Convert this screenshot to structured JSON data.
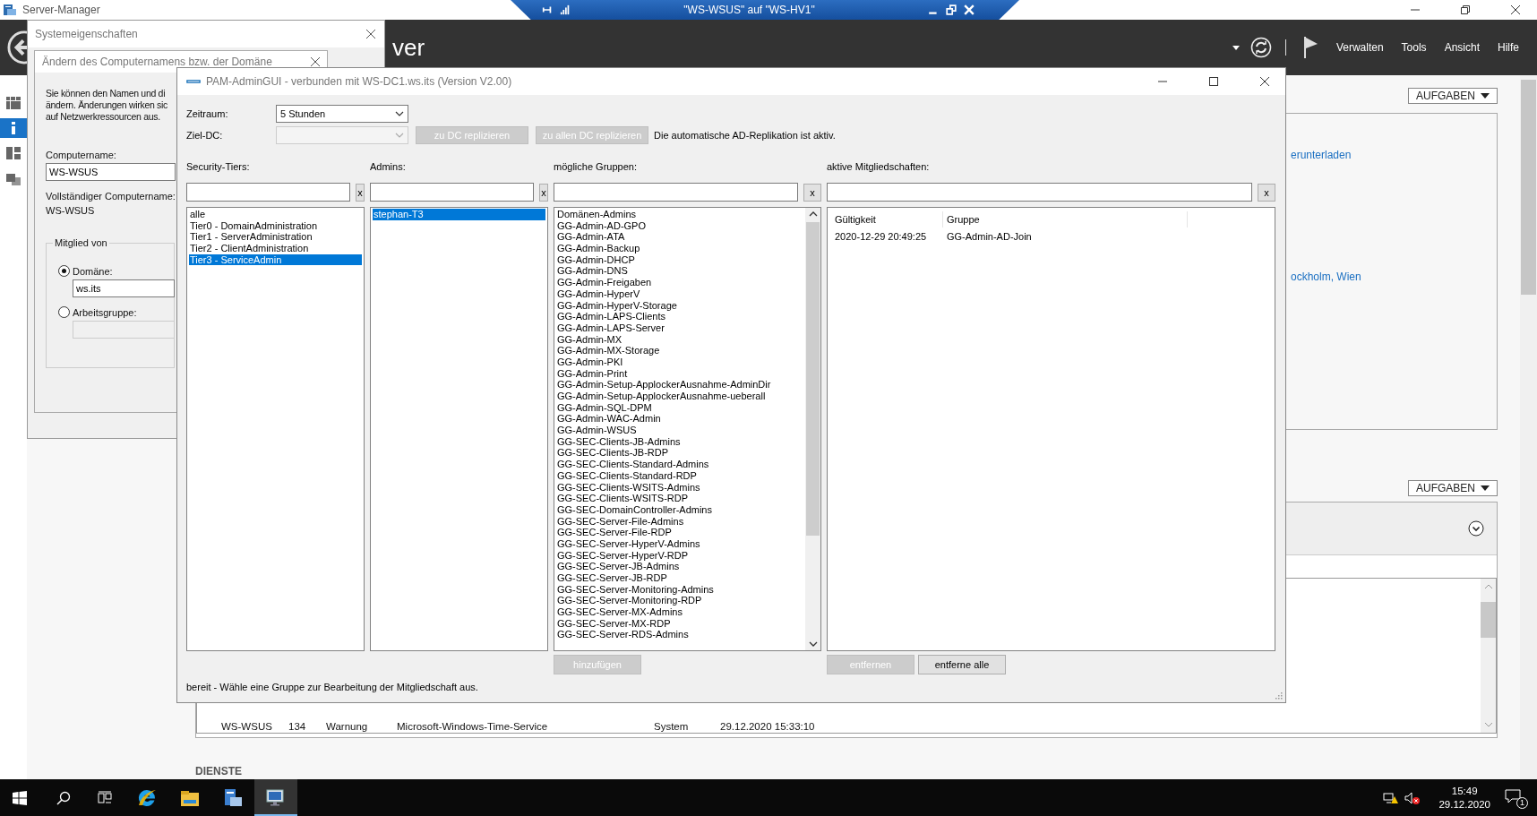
{
  "server_manager": {
    "title": "Server-Manager",
    "header_title": "ver",
    "menu": [
      "Verwalten",
      "Tools",
      "Ansicht",
      "Hilfe"
    ],
    "nav": [
      {
        "selected": false
      },
      {
        "selected": true
      },
      {
        "selected": false
      },
      {
        "selected": false
      }
    ],
    "tasks_buttons": [
      "AUFGABEN",
      "AUFGABEN"
    ],
    "links": [
      "erunterladen",
      "ockholm, Wien"
    ],
    "events_row": [
      "WS-WSUS",
      "134",
      "Warnung",
      "Microsoft-Windows-Time-Service",
      "System",
      "29.12.2020 15:33:10"
    ],
    "section": "DIENSTE"
  },
  "remote_bar": {
    "title": "\"WS-WSUS\" auf \"WS-HV1\""
  },
  "system_properties": {
    "title": "Systemeigenschaften",
    "dialog_title": "Ändern des Computernamens bzw. der Domäne",
    "intro": [
      "Sie können den Namen und di",
      "ändern. Änderungen wirken sic",
      "auf Netzwerkressourcen aus."
    ],
    "computer_name_label": "Computername:",
    "computer_name": "WS-WSUS",
    "full_name_label": "Vollständiger Computername:",
    "full_name": "WS-WSUS",
    "member_of": "Mitglied von",
    "options": [
      {
        "label": "Domäne:",
        "selected": true,
        "value": "ws.its"
      },
      {
        "label": "Arbeitsgruppe:",
        "selected": false
      }
    ]
  },
  "pam": {
    "title": "PAM-AdminGUI - verbunden mit WS-DC1.ws.its (Version V2.00)",
    "timeframe": {
      "label": "Zeitraum:",
      "value": "5 Stunden"
    },
    "target_dc": {
      "label": "Ziel-DC:",
      "disabled": true
    },
    "replicate_buttons": [
      {
        "label": "zu DC replizieren",
        "disabled": true
      },
      {
        "label": "zu allen DC replizieren",
        "disabled": true
      }
    ],
    "replication_note": "Die automatische AD-Replikation ist aktiv.",
    "columns": [
      {
        "label": "Security-Tiers:",
        "clear": "x",
        "scroll": false,
        "items": [
          {
            "text": "alle",
            "selected": false
          },
          {
            "text": "Tier0 - DomainAdministration",
            "selected": false
          },
          {
            "text": "Tier1 - ServerAdministration",
            "selected": false
          },
          {
            "text": "Tier2 - ClientAdministration",
            "selected": false
          },
          {
            "text": "Tier3 - ServiceAdmin",
            "selected": true
          }
        ]
      },
      {
        "label": "Admins:",
        "clear": "x",
        "scroll": false,
        "items": [
          {
            "text": "stephan-T3",
            "selected": true
          }
        ]
      },
      {
        "label": "mögliche Gruppen:",
        "clear": "x",
        "scroll": true,
        "items": [
          {
            "text": "Domänen-Admins",
            "selected": false
          },
          {
            "text": "GG-Admin-AD-GPO",
            "selected": false
          },
          {
            "text": "GG-Admin-ATA",
            "selected": false
          },
          {
            "text": "GG-Admin-Backup",
            "selected": false
          },
          {
            "text": "GG-Admin-DHCP",
            "selected": false
          },
          {
            "text": "GG-Admin-DNS",
            "selected": false
          },
          {
            "text": "GG-Admin-Freigaben",
            "selected": false
          },
          {
            "text": "GG-Admin-HyperV",
            "selected": false
          },
          {
            "text": "GG-Admin-HyperV-Storage",
            "selected": false
          },
          {
            "text": "GG-Admin-LAPS-Clients",
            "selected": false
          },
          {
            "text": "GG-Admin-LAPS-Server",
            "selected": false
          },
          {
            "text": "GG-Admin-MX",
            "selected": false
          },
          {
            "text": "GG-Admin-MX-Storage",
            "selected": false
          },
          {
            "text": "GG-Admin-PKI",
            "selected": false
          },
          {
            "text": "GG-Admin-Print",
            "selected": false
          },
          {
            "text": "GG-Admin-Setup-ApplockerAusnahme-AdminDir",
            "selected": false
          },
          {
            "text": "GG-Admin-Setup-ApplockerAusnahme-ueberall",
            "selected": false
          },
          {
            "text": "GG-Admin-SQL-DPM",
            "selected": false
          },
          {
            "text": "GG-Admin-WAC-Admin",
            "selected": false
          },
          {
            "text": "GG-Admin-WSUS",
            "selected": false
          },
          {
            "text": "GG-SEC-Clients-JB-Admins",
            "selected": false
          },
          {
            "text": "GG-SEC-Clients-JB-RDP",
            "selected": false
          },
          {
            "text": "GG-SEC-Clients-Standard-Admins",
            "selected": false
          },
          {
            "text": "GG-SEC-Clients-Standard-RDP",
            "selected": false
          },
          {
            "text": "GG-SEC-Clients-WSITS-Admins",
            "selected": false
          },
          {
            "text": "GG-SEC-Clients-WSITS-RDP",
            "selected": false
          },
          {
            "text": "GG-SEC-DomainController-Admins",
            "selected": false
          },
          {
            "text": "GG-SEC-Server-File-Admins",
            "selected": false
          },
          {
            "text": "GG-SEC-Server-File-RDP",
            "selected": false
          },
          {
            "text": "GG-SEC-Server-HyperV-Admins",
            "selected": false
          },
          {
            "text": "GG-SEC-Server-HyperV-RDP",
            "selected": false
          },
          {
            "text": "GG-SEC-Server-JB-Admins",
            "selected": false
          },
          {
            "text": "GG-SEC-Server-JB-RDP",
            "selected": false
          },
          {
            "text": "GG-SEC-Server-Monitoring-Admins",
            "selected": false
          },
          {
            "text": "GG-SEC-Server-Monitoring-RDP",
            "selected": false
          },
          {
            "text": "GG-SEC-Server-MX-Admins",
            "selected": false
          },
          {
            "text": "GG-SEC-Server-MX-RDP",
            "selected": false
          },
          {
            "text": "GG-SEC-Server-RDS-Admins",
            "selected": false
          }
        ]
      }
    ],
    "memberships": {
      "label": "aktive Mitgliedschaften:",
      "clear": "x",
      "headers": [
        "Gültigkeit",
        "Gruppe"
      ],
      "rows": [
        [
          "2020-12-29 20:49:25",
          "GG-Admin-AD-Join"
        ]
      ]
    },
    "add_button": {
      "label": "hinzufügen",
      "disabled": true
    },
    "remove_buttons": [
      {
        "label": "entfernen",
        "disabled": true
      },
      {
        "label": "entferne alle",
        "disabled": false
      }
    ],
    "status": "bereit - Wähle eine Gruppe zur Bearbeitung der Mitgliedschaft aus."
  },
  "taskbar": {
    "apps": [
      {
        "selected": false
      },
      {
        "selected": false
      },
      {
        "selected": false
      },
      {
        "selected": true
      }
    ],
    "time": "15:49",
    "date": "29.12.2020",
    "notifications": "1"
  }
}
